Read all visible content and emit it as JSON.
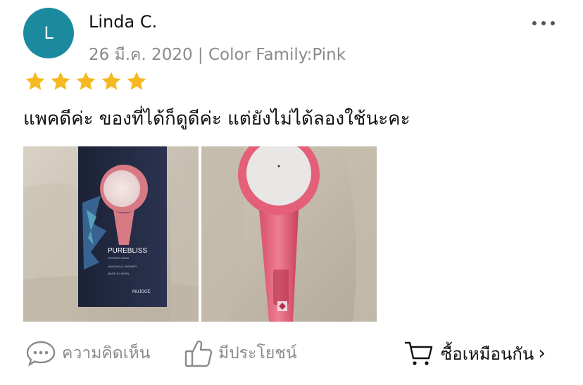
{
  "reviewer": {
    "avatar_initial": "L",
    "avatar_color": "#1b8a9e",
    "name": "Linda C.",
    "meta": "26 มี.ค. 2020 | Color Family:Pink"
  },
  "rating": {
    "stars": 5,
    "max": 5,
    "star_color": "#f5b921"
  },
  "review_text": "แพคดีค่ะ ของที่ได้ก็ดูดีค่ะ แต่ยังไม่ได้ลองใช้นะคะ",
  "photos": [
    {
      "brand": "PUREBLISS",
      "brand_sub": "SHOWER HEAD",
      "box_line1": "HANDHELD SHOWER",
      "box_line2": "MADE IN JAPAN",
      "box_logo": "MUJOGE"
    },
    {
      "icon": "shower-head-photo"
    }
  ],
  "actions": {
    "comment_label": "ความคิดเห็น",
    "helpful_label": "มีประโยชน์",
    "buy_label": "ซื้อเหมือนกัน",
    "chevron": "›"
  },
  "menu_icon": "more-dots-icon"
}
